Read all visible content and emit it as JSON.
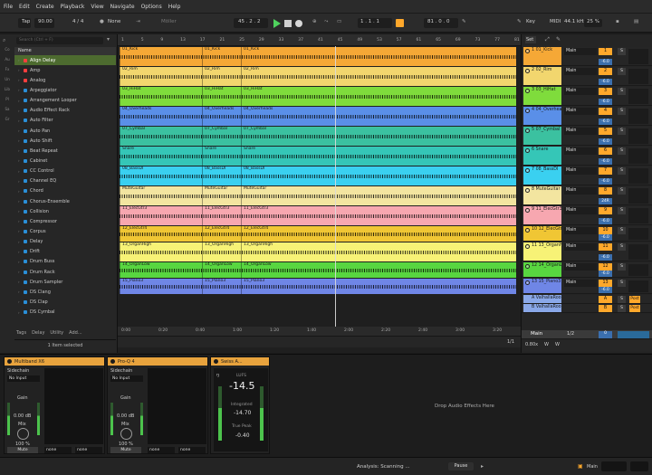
{
  "menu": [
    "File",
    "Edit",
    "Create",
    "Playback",
    "View",
    "Navigate",
    "Options",
    "Help"
  ],
  "control": {
    "tap": "Tap",
    "tempo": "90.00",
    "signature": "4 / 4",
    "metronome": "None",
    "groove": "Möller",
    "position": "45 .  2 .  2",
    "loop_start": "1 .  1 .  1",
    "loop_length": "81 .  0 .  0",
    "key": "Key",
    "midi": "MIDI",
    "sample_rate": "44.1 kHz",
    "cpu": "25 %",
    "colors": {
      "accent": "#ffa82b",
      "play": "#4fd25d",
      "record": "#ff6b3a"
    }
  },
  "browser": {
    "search_placeholder": "Search (Ctrl + F)",
    "column_header": "Name",
    "side_labels": [
      "Co",
      "Au",
      "Fx",
      "Un",
      "Lib",
      "Pl",
      "Sa",
      "Gr"
    ],
    "items": [
      {
        "label": "Align Delay",
        "color": "#ff3e3e"
      },
      {
        "label": "Amp",
        "color": "#ff3e3e"
      },
      {
        "label": "Analog",
        "color": "#ff3e3e"
      },
      {
        "label": "Arpeggiator",
        "color": "#2a8fd8"
      },
      {
        "label": "Arrangement Looper",
        "color": "#2a8fd8"
      },
      {
        "label": "Audio Effect Rack",
        "color": "#2a8fd8"
      },
      {
        "label": "Auto Filter",
        "color": "#2a8fd8"
      },
      {
        "label": "Auto Pan",
        "color": "#2a8fd8"
      },
      {
        "label": "Auto Shift",
        "color": "#2a8fd8"
      },
      {
        "label": "Beat Repeat",
        "color": "#2a8fd8"
      },
      {
        "label": "Cabinet",
        "color": "#2a8fd8"
      },
      {
        "label": "CC Control",
        "color": "#2a8fd8"
      },
      {
        "label": "Channel EQ",
        "color": "#2a8fd8"
      },
      {
        "label": "Chord",
        "color": "#2a8fd8"
      },
      {
        "label": "Chorus-Ensemble",
        "color": "#2a8fd8"
      },
      {
        "label": "Collision",
        "color": "#2a8fd8"
      },
      {
        "label": "Compressor",
        "color": "#2a8fd8"
      },
      {
        "label": "Corpus",
        "color": "#2a8fd8"
      },
      {
        "label": "Delay",
        "color": "#2a8fd8"
      },
      {
        "label": "Drift",
        "color": "#2a8fd8"
      },
      {
        "label": "Drum Buss",
        "color": "#2a8fd8"
      },
      {
        "label": "Drum Rack",
        "color": "#2a8fd8"
      },
      {
        "label": "Drum Sampler",
        "color": "#2a8fd8"
      },
      {
        "label": "DS Clang",
        "color": "#2a8fd8"
      },
      {
        "label": "DS Clap",
        "color": "#2a8fd8"
      },
      {
        "label": "DS Cymbal",
        "color": "#2a8fd8"
      }
    ],
    "tabs": [
      "Tags",
      "Delay",
      "Utility",
      "Add..."
    ],
    "status": "1 Item selected"
  },
  "ruler_marks": [
    "1",
    "5",
    "9",
    "13",
    "17",
    "21",
    "25",
    "29",
    "33",
    "37",
    "41",
    "45",
    "49",
    "53",
    "57",
    "61",
    "65",
    "69",
    "73",
    "77",
    "81"
  ],
  "time_marks": [
    "0:00",
    "0:20",
    "0:40",
    "1:00",
    "1:20",
    "1:40",
    "2:00",
    "2:20",
    "2:40",
    "3:00",
    "3:20"
  ],
  "tracks": [
    {
      "clips": [
        "01_Kick",
        "01_Kick",
        "01_Kick"
      ],
      "color": "#f5a836",
      "channel": "1 01_Kick",
      "num": "1"
    },
    {
      "clips": [
        "02_Rim",
        "02_Rim",
        "02_Rim"
      ],
      "color": "#f2d66e",
      "channel": "2 02_Rim",
      "num": "2"
    },
    {
      "clips": [
        "03_HiHat",
        "03_HiHat",
        "03_HiHat"
      ],
      "color": "#7fdc3c",
      "channel": "3 03_HiHat",
      "num": "3"
    },
    {
      "clips": [
        "04_Overheads",
        "04_Overheads",
        "04_Overheads"
      ],
      "color": "#5a8fe8",
      "channel": "4 04_Overhea",
      "num": "4"
    },
    {
      "clips": [
        "07_Cymbal",
        "07_Cymbal",
        "07_Cymbal"
      ],
      "color": "#3bc1a0",
      "channel": "5 07_Cymbal",
      "num": "5"
    },
    {
      "clips": [
        "Snare",
        "Snare",
        "Snare"
      ],
      "color": "#35c6b7",
      "channel": "6 Snare",
      "num": "6"
    },
    {
      "clips": [
        "08_BassDI",
        "08_BassDI",
        "08_BassDI"
      ],
      "color": "#3ad0f0",
      "channel": "7 08_BassDI",
      "num": "7"
    },
    {
      "clips": [
        "MuteGuitar",
        "MuteGuitar",
        "MuteGuitar"
      ],
      "color": "#f3e5a0",
      "channel": "8 MuteGuitar",
      "num": "8"
    },
    {
      "clips": [
        "11_ElecGtr3",
        "11_ElecGtr3",
        "11_ElecGtr3"
      ],
      "color": "#f7a7b0",
      "channel": "9 11_ElecGtr3",
      "num": "9"
    },
    {
      "clips": [
        "12_ElecGtr4",
        "12_ElecGtr4",
        "12_ElecGtr4"
      ],
      "color": "#f0c634",
      "channel": "10 12_ElecGtr4",
      "num": "10"
    },
    {
      "clips": [
        "13_OrganHigh",
        "13_OrganHigh",
        "13_OrganHigh"
      ],
      "color": "#f7f276",
      "channel": "11 13_OrganHi",
      "num": "11"
    },
    {
      "clips": [
        "14_OrganLow",
        "14_OrganLow",
        "14_OrganLow"
      ],
      "color": "#58d640",
      "channel": "12 14_OrganLo",
      "num": "12"
    },
    {
      "clips": [
        "15_Piano3",
        "15_Piano3",
        "15_Piano3"
      ],
      "color": "#6f86e6",
      "channel": "13 15_Piano3",
      "num": "13"
    }
  ],
  "returns": [
    {
      "label": "A ValhallaRoo",
      "num": "A"
    },
    {
      "label": "B ValhallaRoo",
      "num": "B"
    }
  ],
  "mixer": {
    "set_label": "Set",
    "output": "Main",
    "solo": "S",
    "volume": "-6.0",
    "pan_special": "24R",
    "post": "Post",
    "main_label": "Main",
    "main_fraction": "1/2",
    "main_volume": "0",
    "main_zoom": "0.80x",
    "main_buttons": [
      "W",
      "W"
    ]
  },
  "arrangement": {
    "status_left": "1/1",
    "zoom": "0.80x"
  },
  "devices": {
    "multiband": {
      "title": "Multiband X6",
      "sidechain": "Sidechain",
      "input": "No Input",
      "gain_label": "Gain",
      "gain_value": "0.00 dB",
      "mix_label": "Mix",
      "mix_value": "100 %",
      "mute": "Mute",
      "out1": "none",
      "out2": "none"
    },
    "proq": {
      "title": "Pro-Q 4",
      "sidechain": "Sidechain",
      "input": "No Input",
      "gain_label": "Gain",
      "gain_value": "0.00 dB",
      "mix_label": "Mix",
      "mix_value": "100 %",
      "mute": "Mute",
      "out1": "none",
      "out2": "none"
    },
    "swiss": {
      "title": "Swiss A...",
      "lufs_label": "LUFS",
      "lufs_value": "-14.5",
      "integrated_label": "Integrated",
      "integrated_value": "-14.70",
      "true_peak_label": "True Peak",
      "true_peak_value": "-0.40"
    },
    "drop_hint": "Drop Audio Effects Here"
  },
  "status": {
    "analysis": "Analysis: Scanning ...",
    "pause": "Pause",
    "main": "Main"
  }
}
